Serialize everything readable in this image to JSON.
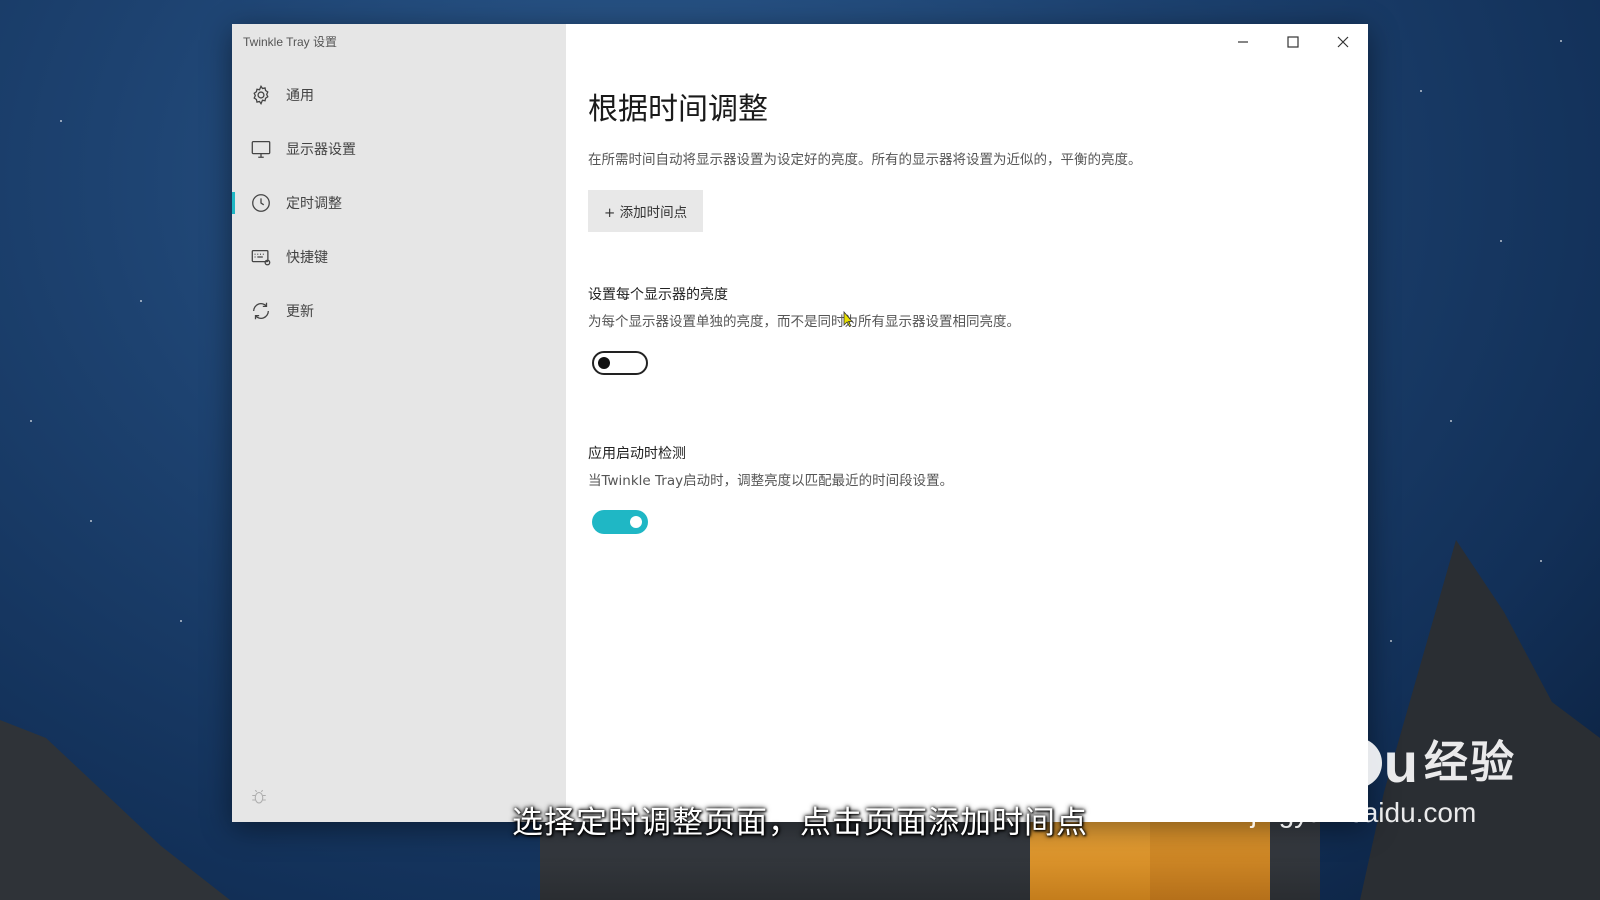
{
  "window": {
    "title": "Twinkle Tray 设置"
  },
  "sidebar": {
    "items": [
      {
        "label": "通用",
        "icon": "gear-icon"
      },
      {
        "label": "显示器设置",
        "icon": "monitor-icon"
      },
      {
        "label": "定时调整",
        "icon": "clock-icon",
        "active": true
      },
      {
        "label": "快捷键",
        "icon": "keyboard-icon"
      },
      {
        "label": "更新",
        "icon": "refresh-icon"
      }
    ]
  },
  "main": {
    "title": "根据时间调整",
    "description": "在所需时间自动将显示器设置为设定好的亮度。所有的显示器将设置为近似的，平衡的亮度。",
    "add_button_label": "+ 添加时间点",
    "per_monitor": {
      "title": "设置每个显示器的亮度",
      "description": "为每个显示器设置单独的亮度，而不是同时为所有显示器设置相同亮度。",
      "enabled": false
    },
    "startup_check": {
      "title": "应用启动时检测",
      "description": "当Twinkle Tray启动时，调整亮度以匹配最近的时间段设置。",
      "enabled": true
    }
  },
  "overlay": {
    "subtitle": "选择定时调整页面，点击页面添加时间点",
    "watermark_logo_left": "Bai",
    "watermark_logo_right": "u",
    "watermark_cn": "经验",
    "watermark_url": "jingyan.baidu.com"
  },
  "colors": {
    "accent": "#1fb7c5",
    "sidebar_bg": "#e6e6e6"
  }
}
